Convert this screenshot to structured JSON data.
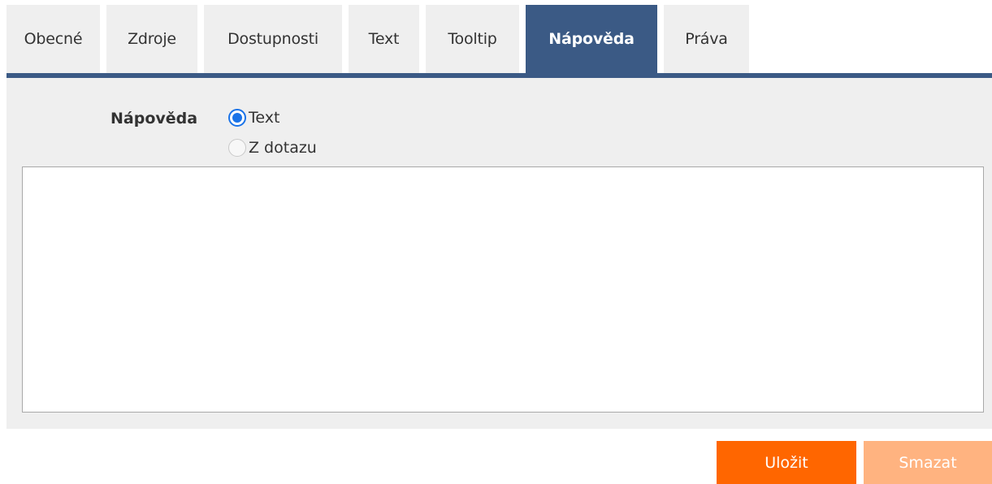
{
  "tabs": [
    {
      "label": "Obecné",
      "active": false
    },
    {
      "label": "Zdroje",
      "active": false
    },
    {
      "label": "Dostupnosti",
      "active": false
    },
    {
      "label": "Text",
      "active": false
    },
    {
      "label": "Tooltip",
      "active": false
    },
    {
      "label": "Nápověda",
      "active": true
    },
    {
      "label": "Práva",
      "active": false
    }
  ],
  "help": {
    "label": "Nápověda",
    "options": [
      {
        "label": "Text",
        "checked": true
      },
      {
        "label": "Z dotazu",
        "checked": false
      }
    ],
    "text_value": ""
  },
  "buttons": {
    "save_label": "Uložit",
    "delete_label": "Smazat"
  },
  "colors": {
    "active_tab": "#3b5a85",
    "save_button": "#ff6600",
    "delete_button": "#ffb380",
    "radio_checked": "#1a73e8"
  }
}
